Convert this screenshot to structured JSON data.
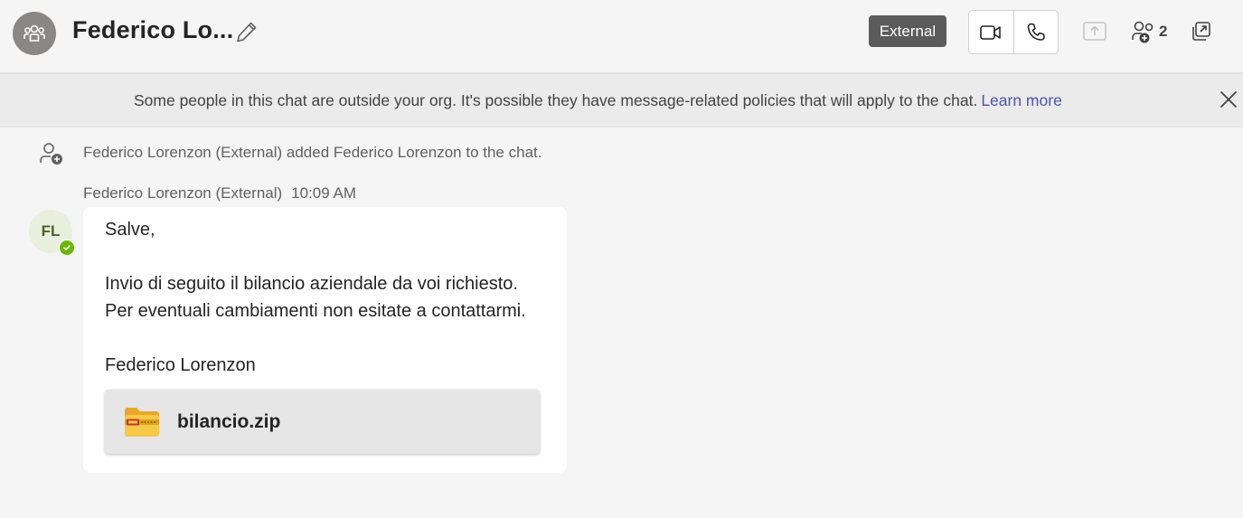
{
  "header": {
    "title": "Federico Lo...",
    "external_badge": "External",
    "participants_count": "2"
  },
  "banner": {
    "text": "Some people in this chat are outside your org. It's possible they have message-related policies that will apply to the chat.",
    "link": "Learn more"
  },
  "system_message": {
    "text": "Federico Lorenzon (External) added Federico Lorenzon to the chat."
  },
  "message": {
    "sender": "Federico Lorenzon (External)",
    "time": "10:09 AM",
    "avatar_initials": "FL",
    "lines": [
      "Salve,",
      "Invio di seguito il bilancio aziendale da voi richiesto.",
      "Per eventuali cambiamenti non esitate a contattarmi.",
      "Federico Lorenzon"
    ],
    "attachment": {
      "name": "bilancio.zip",
      "icon": "zip-folder-icon"
    }
  },
  "icons": {
    "group_avatar": "group-icon",
    "edit": "pencil-icon",
    "video": "video-camera-icon",
    "call": "phone-icon",
    "share": "share-screen-icon",
    "participants": "people-add-icon",
    "popout": "popout-icon",
    "close": "close-icon",
    "system": "person-add-icon",
    "presence": "available-check-icon"
  },
  "colors": {
    "link": "#4f52b2",
    "badge_bg": "#5b5b5b",
    "presence_available": "#6bb700",
    "zip_folder": "#f7c948"
  }
}
